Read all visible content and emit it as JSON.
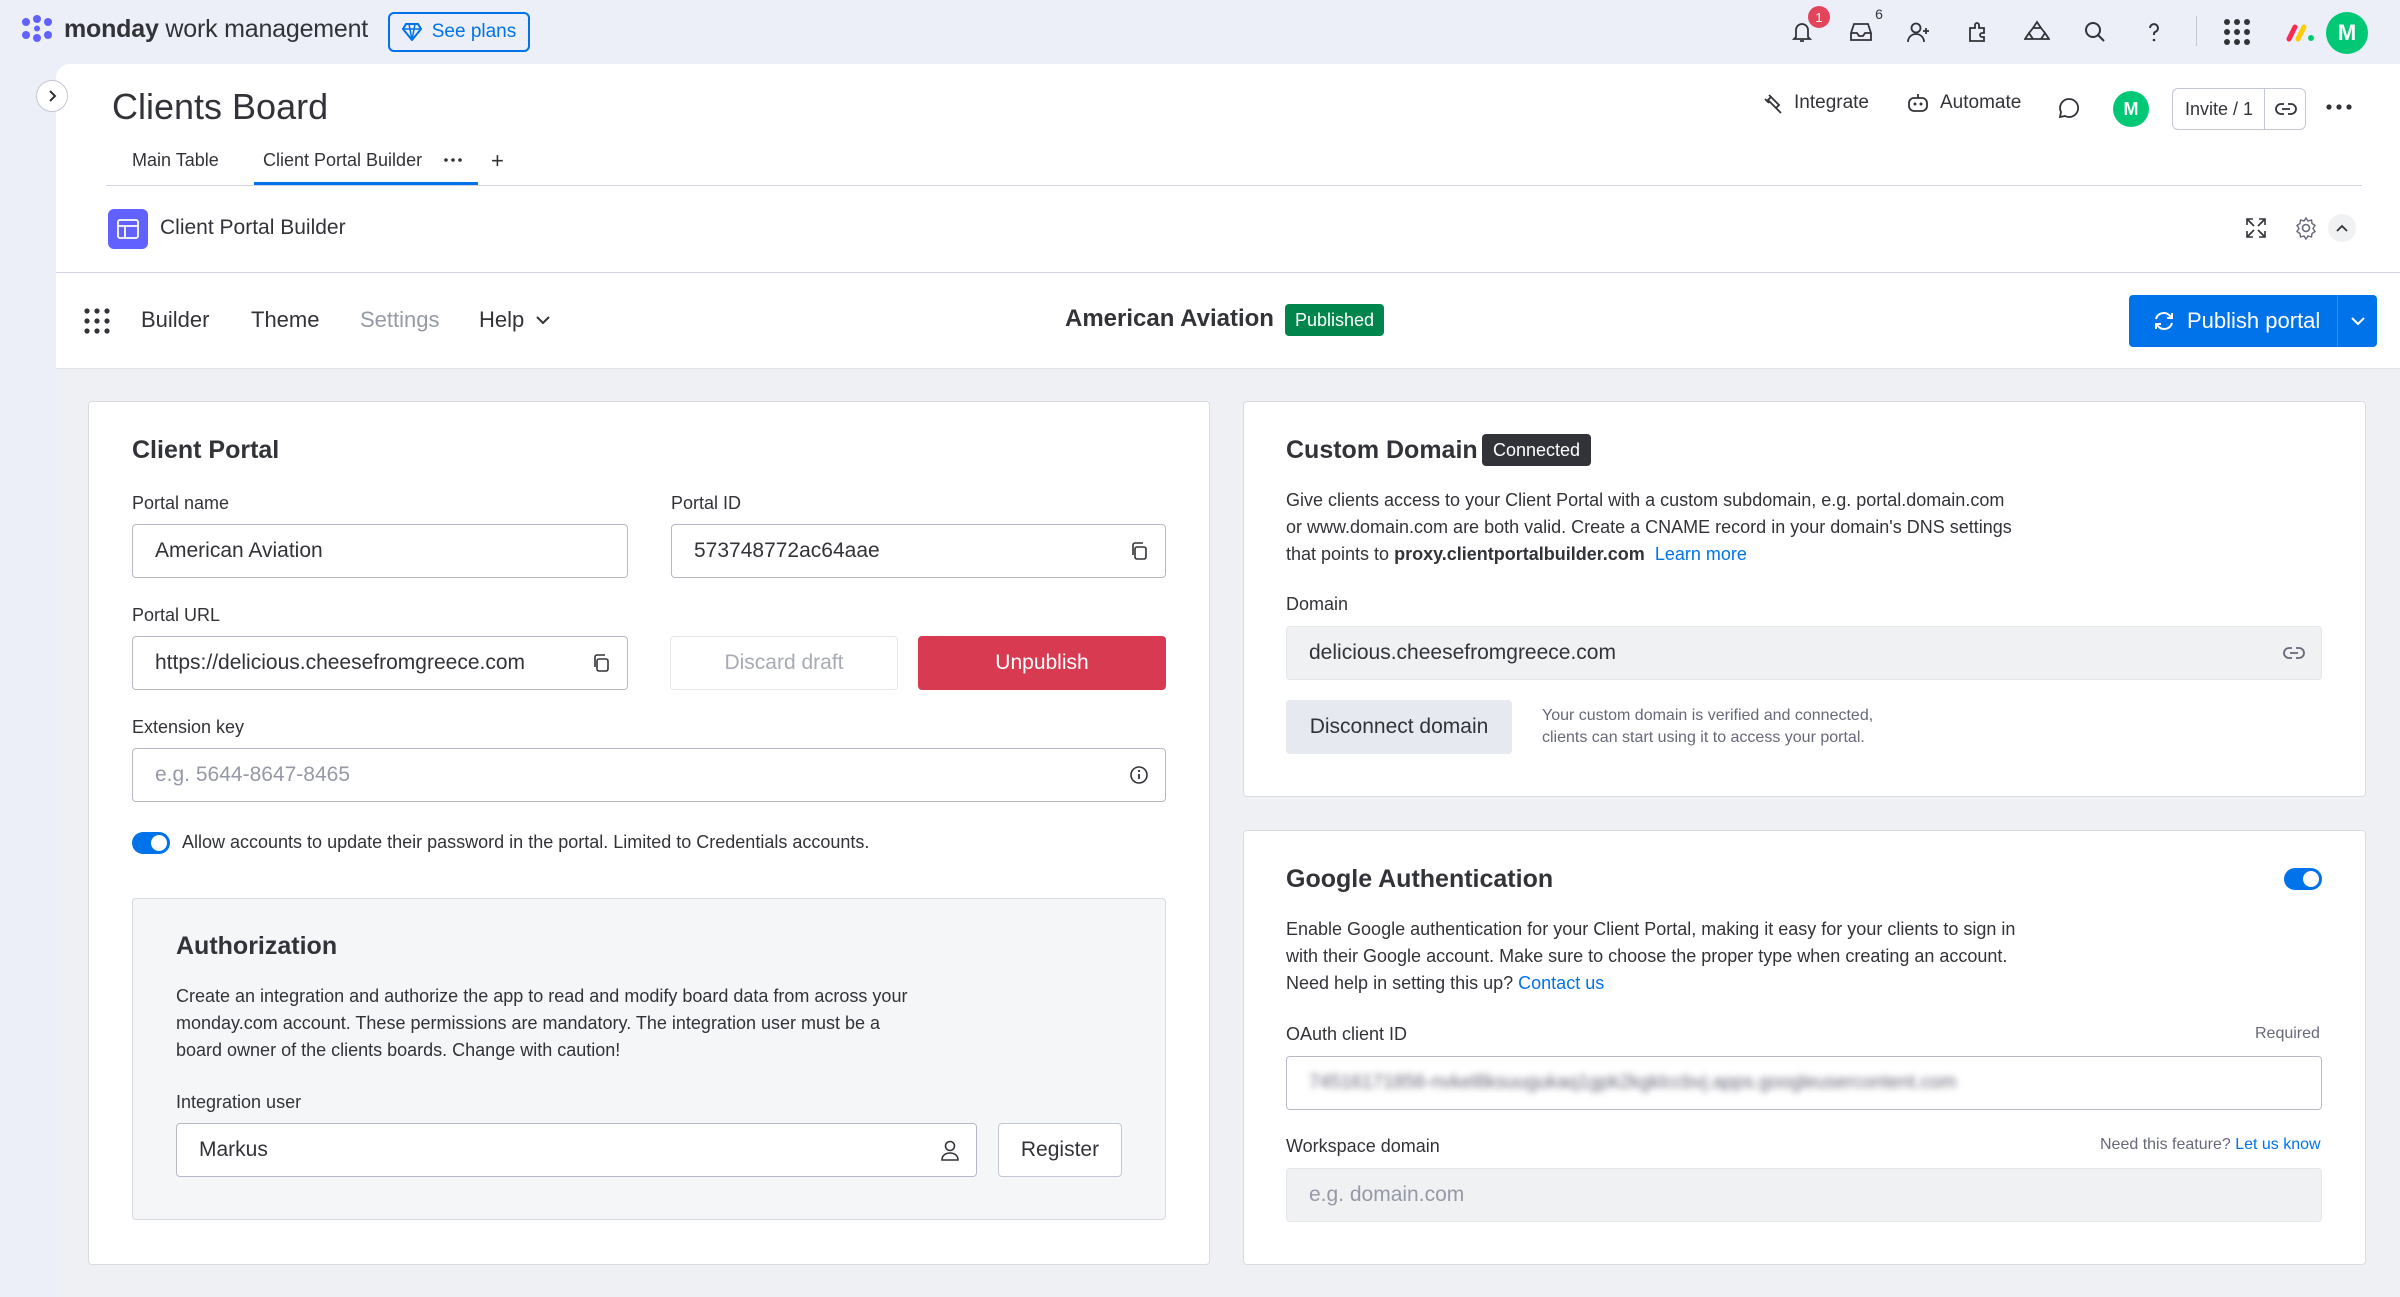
{
  "app": {
    "brand_bold": "monday",
    "brand_rest": " work management",
    "see_plans": "See plans",
    "notifications_count": "1",
    "inbox_count": "6",
    "user_initial": "M"
  },
  "board": {
    "title": "Clients Board",
    "tabs": [
      {
        "label": "Main Table"
      },
      {
        "label": "Client Portal Builder"
      }
    ],
    "add_tab": "+",
    "integrate": "Integrate",
    "automate": "Automate",
    "member_initial": "M",
    "invite": "Invite / 1"
  },
  "view": {
    "title": "Client Portal Builder"
  },
  "portal_toolbar": {
    "nav": [
      "Builder",
      "Theme",
      "Settings",
      "Help"
    ],
    "portal_name": "American Aviation",
    "status": "Published",
    "publish_button": "Publish portal"
  },
  "client_portal": {
    "title": "Client Portal",
    "portal_name_label": "Portal name",
    "portal_name_value": "American Aviation",
    "portal_id_label": "Portal ID",
    "portal_id_value": "573748772ac64aae",
    "portal_url_label": "Portal URL",
    "portal_url_value": "https://delicious.cheesefromgreece.com",
    "discard_draft": "Discard draft",
    "unpublish": "Unpublish",
    "extension_key_label": "Extension key",
    "extension_key_placeholder": "e.g. 5644-8647-8465",
    "allow_password_update": "Allow accounts to update their password in the portal. Limited to Credentials accounts.",
    "allow_password_update_enabled": true
  },
  "authorization": {
    "title": "Authorization",
    "description_1": "Create an integration and authorize the app to read and modify board data from across your",
    "description_2": "monday.com account. These permissions are mandatory. The integration user must be a",
    "description_3": "board owner of the clients boards. Change with caution!",
    "integration_user_label": "Integration user",
    "integration_user_value": "Markus",
    "register": "Register"
  },
  "custom_domain": {
    "title": "Custom Domain",
    "status": "Connected",
    "description_1": "Give clients access to your Client Portal with a custom subdomain, e.g. portal.domain.com",
    "description_2": "or www.domain.com are both valid. Create a CNAME record in your domain's DNS settings",
    "description_3_prefix": "that points to ",
    "cname_target": "proxy.clientportalbuilder.com",
    "learn_more": "Learn more",
    "domain_label": "Domain",
    "domain_value": "delicious.cheesefromgreece.com",
    "disconnect": "Disconnect domain",
    "verified_note_1": "Your custom domain is verified and connected,",
    "verified_note_2": "clients can start using it to access your portal."
  },
  "google_auth": {
    "title": "Google Authentication",
    "enabled": true,
    "description_1": "Enable Google authentication for your Client Portal, making it easy for your clients to sign in",
    "description_2": "with their Google account. Make sure to choose the proper type when creating an account.",
    "description_3_prefix": "Need help in setting this up? ",
    "contact_us": "Contact us",
    "oauth_label": "OAuth client ID",
    "required": "Required",
    "oauth_value": "745161718​56-nvkel8ksuugukaq1gpk2kgklccbvj.apps.googleusercontent.com",
    "workspace_label": "Workspace domain",
    "need_feature": "Need this feature?",
    "let_us_know": "Let us know",
    "workspace_placeholder": "e.g. domain.com"
  }
}
